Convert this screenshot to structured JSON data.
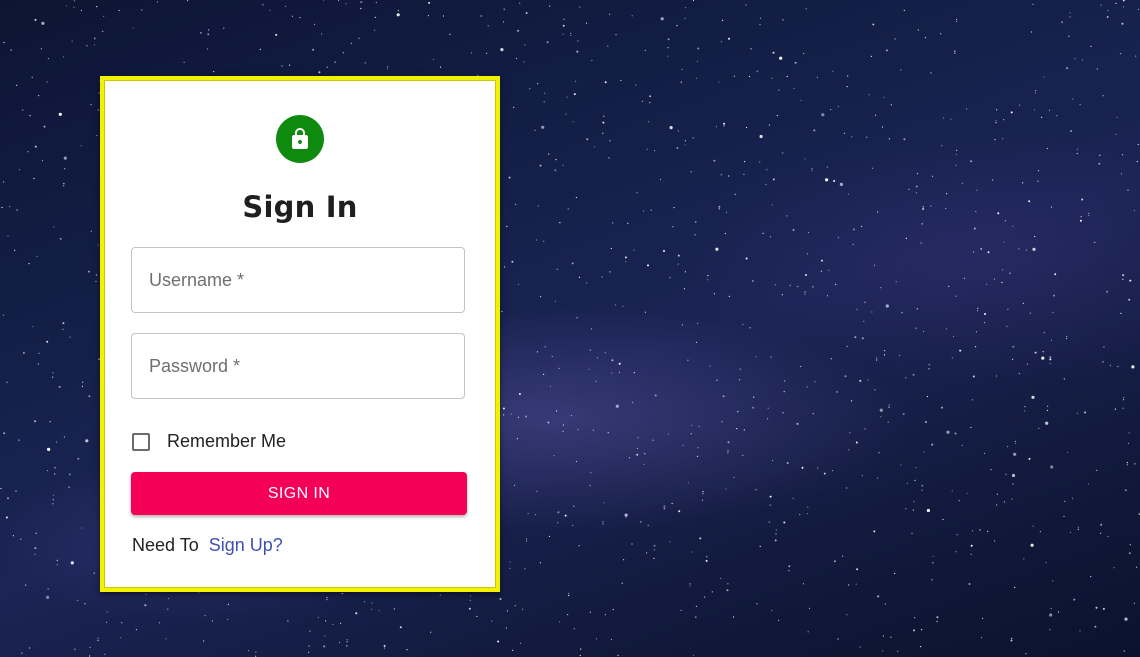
{
  "colors": {
    "card_border": "#f2f200",
    "lock_avatar_bg": "#0e8a0e",
    "button_bg": "#f50057",
    "link": "#3f51b5"
  },
  "header": {
    "icon": "lock-icon",
    "title": "Sign In"
  },
  "form": {
    "username_placeholder": "Username *",
    "password_placeholder": "Password *",
    "remember_label": "Remember Me",
    "remember_checked": false,
    "submit_label": "SIGN IN"
  },
  "footer": {
    "prompt": "Need To",
    "link_label": "Sign Up?"
  }
}
